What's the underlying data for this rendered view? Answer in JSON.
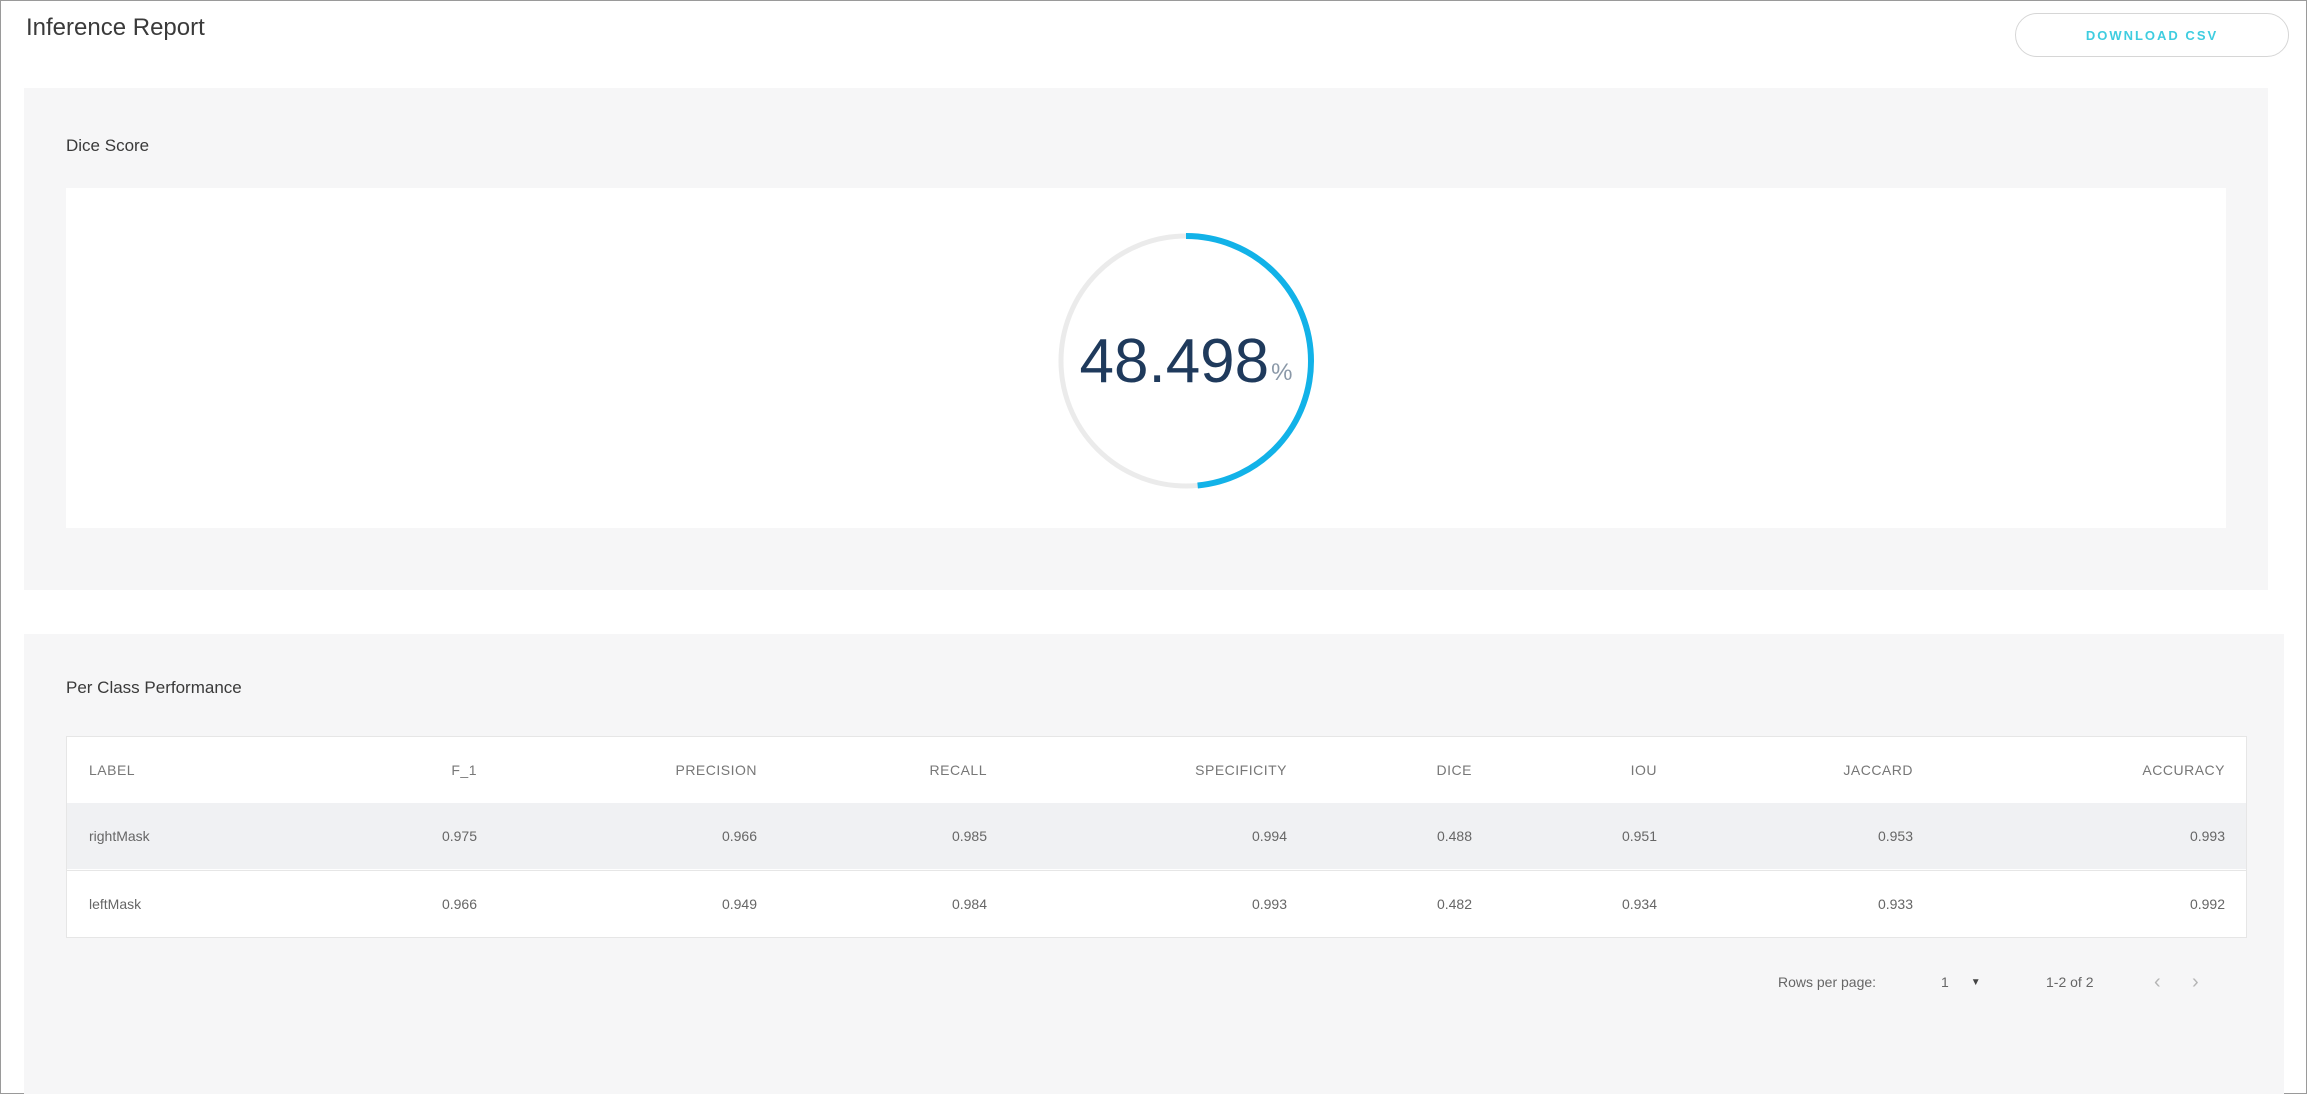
{
  "header": {
    "title": "Inference Report",
    "download_label": "DOWNLOAD CSV"
  },
  "dice_score": {
    "title": "Dice Score",
    "value": "48.498",
    "unit": "%",
    "progress_fraction": 0.48498,
    "accent_color": "#12b2e8",
    "track_color": "#ebebeb"
  },
  "per_class": {
    "title": "Per Class Performance",
    "columns": [
      "LABEL",
      "F_1",
      "PRECISION",
      "RECALL",
      "SPECIFICITY",
      "DICE",
      "IOU",
      "JACCARD",
      "ACCURACY"
    ],
    "rows": [
      [
        "rightMask",
        "0.975",
        "0.966",
        "0.985",
        "0.994",
        "0.488",
        "0.951",
        "0.953",
        "0.993"
      ],
      [
        "leftMask",
        "0.966",
        "0.949",
        "0.984",
        "0.993",
        "0.482",
        "0.934",
        "0.933",
        "0.992"
      ]
    ]
  },
  "pagination": {
    "rows_per_page_label": "Rows per page:",
    "rows_per_page_value": "1",
    "range_text": "1-2 of 2",
    "prev_icon": "chevron-left-icon",
    "next_icon": "chevron-right-icon"
  }
}
